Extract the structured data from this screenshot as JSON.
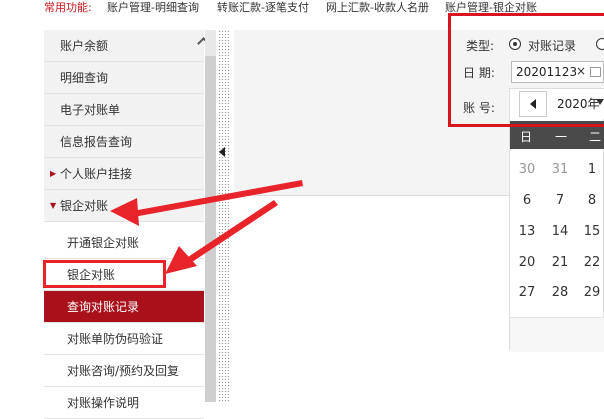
{
  "topbar": {
    "label": "常用功能:",
    "links": [
      "账户管理-明细查询",
      "转账汇款-逐笔支付",
      "网上汇款-收款人名册",
      "账户管理-银企对账"
    ]
  },
  "menu": {
    "items": [
      {
        "label": "账户余额"
      },
      {
        "label": "明细查询"
      },
      {
        "label": "电子对账单"
      },
      {
        "label": "信息报告查询"
      },
      {
        "label": "个人账户挂接"
      },
      {
        "label": "银企对账"
      },
      {
        "label": "开通银企对账"
      },
      {
        "label": "银企对账"
      },
      {
        "label": "查询对账记录"
      },
      {
        "label": "对账单防伪码验证"
      },
      {
        "label": "对账咨询/预约及回复"
      },
      {
        "label": "对账操作说明"
      }
    ]
  },
  "form": {
    "type_label": "类型:",
    "type_option": "对账记录",
    "date_label": "日 期:",
    "date_value": "20201123",
    "clear_glyph": "×",
    "account_label": "账 号:"
  },
  "calendar": {
    "year": "2020年",
    "weekdays": [
      "日",
      "一",
      "二"
    ],
    "rows": [
      [
        "30",
        "31",
        "1"
      ],
      [
        "6",
        "7",
        "8"
      ],
      [
        "13",
        "14",
        "15"
      ],
      [
        "20",
        "21",
        "22"
      ],
      [
        "27",
        "28",
        "29"
      ]
    ]
  },
  "colors": {
    "accent_red": "#a8101b",
    "annotation_red": "#e8232a"
  }
}
